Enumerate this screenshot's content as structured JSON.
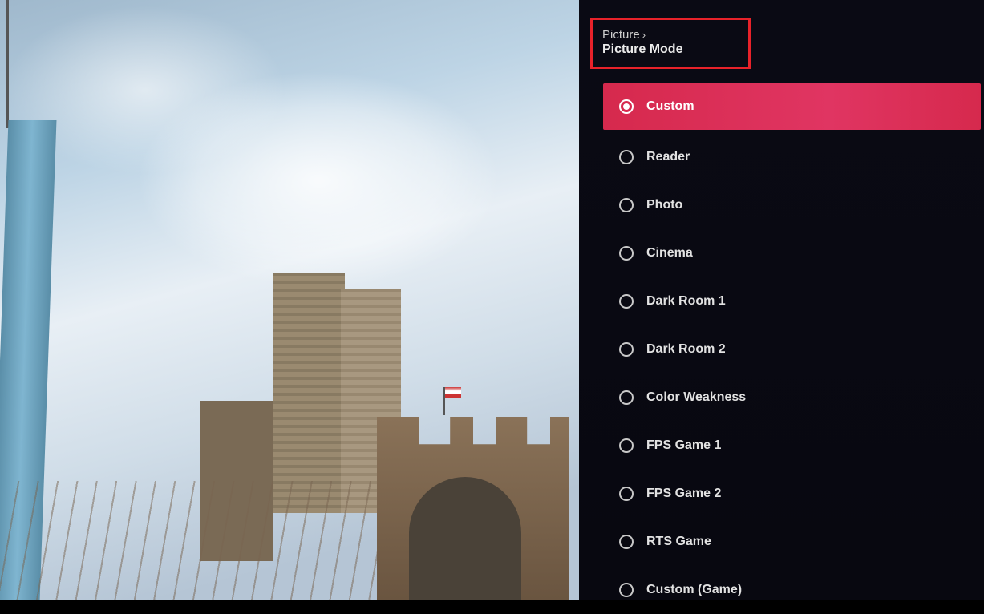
{
  "breadcrumb": {
    "parent": "Picture",
    "title": "Picture Mode"
  },
  "options": [
    {
      "label": "Custom",
      "selected": true
    },
    {
      "label": "Reader",
      "selected": false
    },
    {
      "label": "Photo",
      "selected": false
    },
    {
      "label": "Cinema",
      "selected": false
    },
    {
      "label": "Dark Room 1",
      "selected": false
    },
    {
      "label": "Dark Room 2",
      "selected": false
    },
    {
      "label": "Color Weakness",
      "selected": false
    },
    {
      "label": "FPS Game 1",
      "selected": false
    },
    {
      "label": "FPS Game 2",
      "selected": false
    },
    {
      "label": "RTS Game",
      "selected": false
    },
    {
      "label": "Custom (Game)",
      "selected": false
    }
  ],
  "colors": {
    "highlight": "#e8222a",
    "selected_row": "#e03562"
  }
}
